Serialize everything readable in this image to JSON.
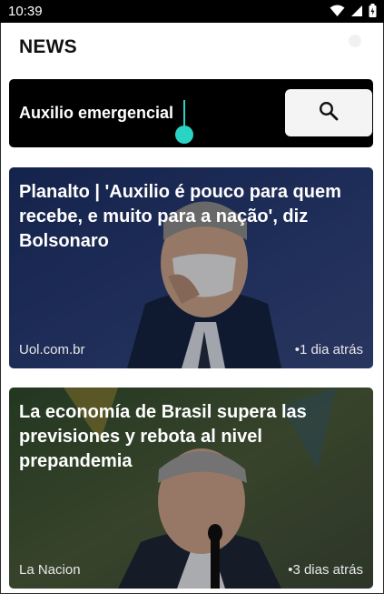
{
  "status_bar": {
    "time": "10:39",
    "icons": [
      "wifi-icon",
      "signal-icon",
      "battery-icon"
    ]
  },
  "header": {
    "title": "NEWS"
  },
  "search": {
    "value": "Auxilio emergencial",
    "button_icon": "search-icon"
  },
  "articles": [
    {
      "title": "Planalto | 'Auxilio é pouco para quem recebe, e muito para a nação', diz Bolsonaro",
      "source": "Uol.com.br",
      "time": "•1 dia atrás"
    },
    {
      "title": "La economía de Brasil supera las previsiones y rebota al nivel prepandemia",
      "source": "La Nacion",
      "time": "•3 dias atrás"
    }
  ],
  "colors": {
    "accent": "#2ad4c4",
    "search_bg": "#000000",
    "card1_tint": "#2b3b63",
    "card2_tint": "#3a4a3a"
  }
}
